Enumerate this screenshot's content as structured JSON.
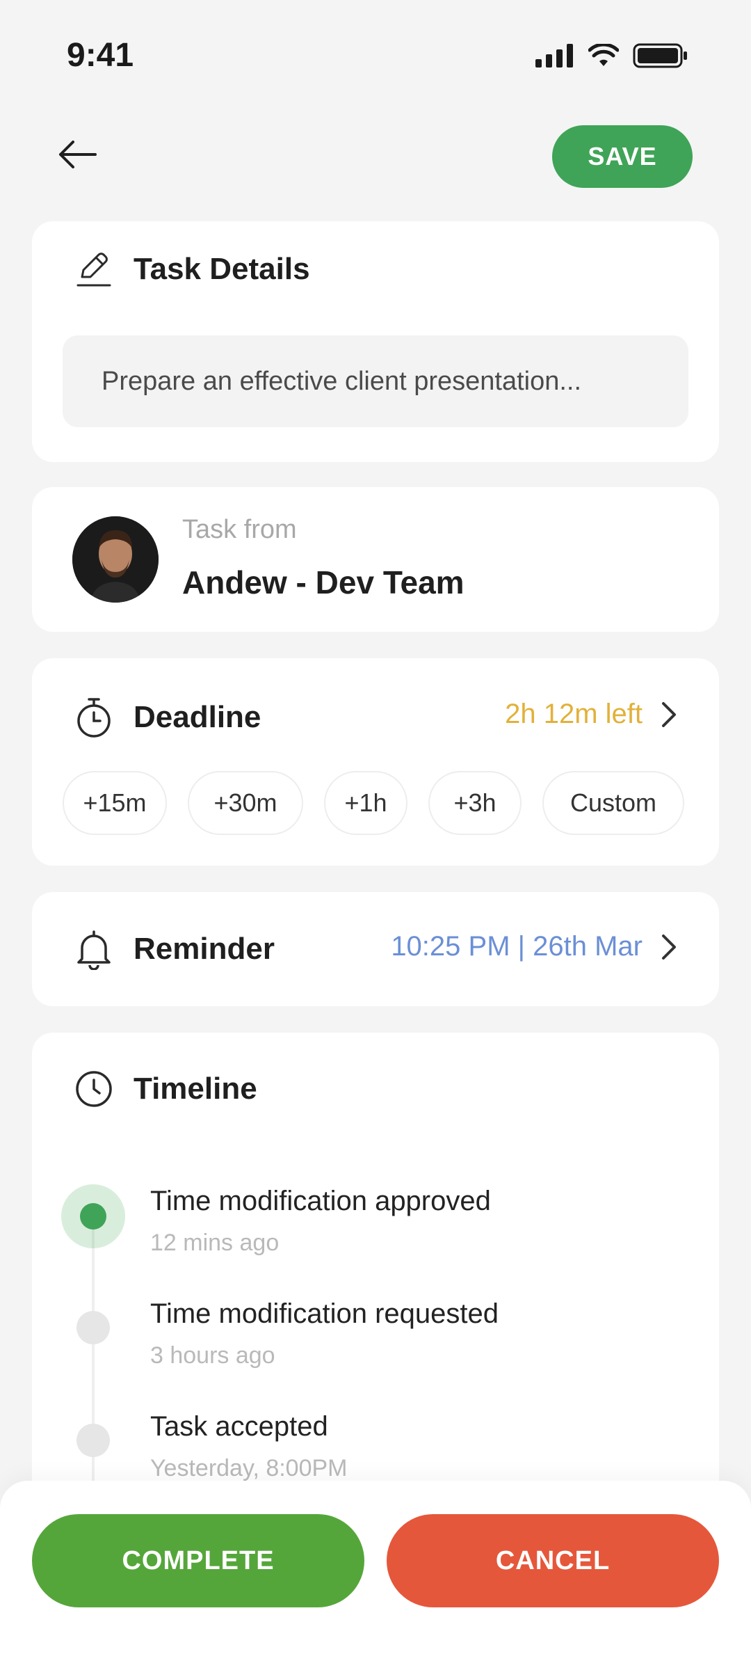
{
  "status_bar": {
    "time": "9:41"
  },
  "header": {
    "save_label": "SAVE"
  },
  "task_details": {
    "title": "Task Details",
    "description": "Prepare an effective client presentation..."
  },
  "task_from": {
    "label": "Task from",
    "name": "Andew - Dev Team"
  },
  "deadline": {
    "title": "Deadline",
    "remaining": "2h 12m left",
    "chips": [
      "+15m",
      "+30m",
      "+1h",
      "+3h",
      "Custom"
    ]
  },
  "reminder": {
    "title": "Reminder",
    "value": "10:25 PM | 26th Mar"
  },
  "timeline": {
    "title": "Timeline",
    "items": [
      {
        "title": "Time modification approved",
        "time": "12 mins ago"
      },
      {
        "title": "Time modification requested",
        "time": "3 hours ago"
      },
      {
        "title": "Task accepted",
        "time": "Yesterday, 8:00PM"
      }
    ]
  },
  "actions": {
    "complete_label": "COMPLETE",
    "cancel_label": "CANCEL"
  },
  "colors": {
    "accent_green": "#3fa457",
    "deadline_amber": "#e2b13a",
    "reminder_blue": "#6b8fd6",
    "cancel_red": "#e5573b"
  }
}
